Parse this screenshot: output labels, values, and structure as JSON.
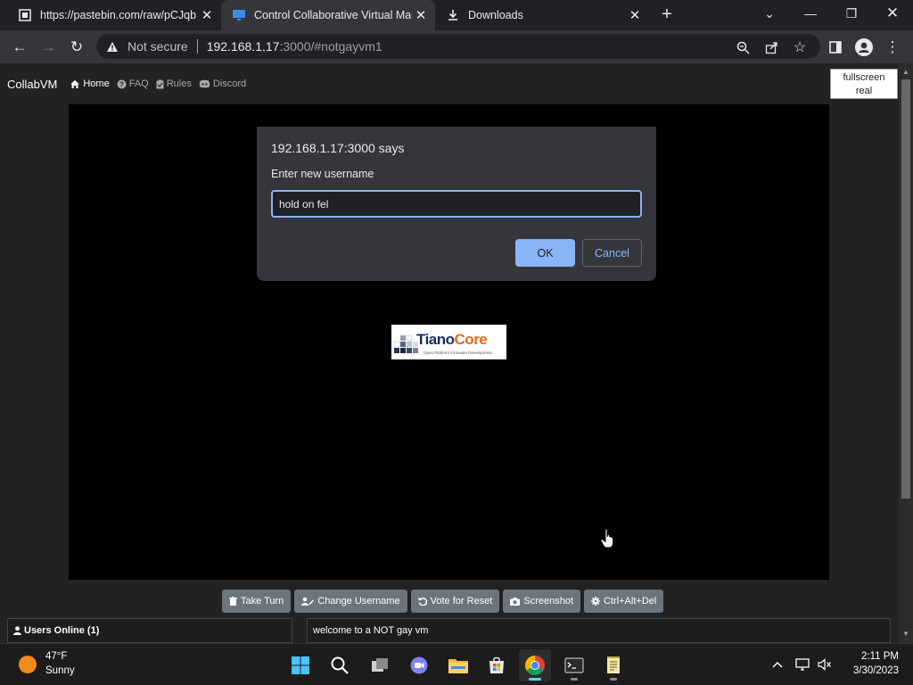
{
  "browser": {
    "tabs": [
      {
        "title": "https://pastebin.com/raw/pCJqb",
        "icon": "pastebin-icon",
        "active": false
      },
      {
        "title": "Control Collaborative Virtual Mac",
        "icon": "monitor-icon",
        "active": true
      },
      {
        "title": "Downloads",
        "icon": "download-icon",
        "active": false
      }
    ],
    "new_tab_label": "+",
    "omnibox": {
      "security_label": "Not secure",
      "url_host": "192.168.1.17",
      "url_rest": ":3000/#notgayvm1"
    }
  },
  "collabvm": {
    "brand": "CollabVM",
    "nav": [
      {
        "label": "Home",
        "icon": "home-icon"
      },
      {
        "label": "FAQ",
        "icon": "question-circle-icon"
      },
      {
        "label": "Rules",
        "icon": "clipboard-icon"
      },
      {
        "label": "Discord",
        "icon": "discord-icon"
      }
    ],
    "fullscreen_label_1": "fullscreen",
    "fullscreen_label_2": "real",
    "vm_logo": {
      "word_a": "Tiano",
      "word_b": "Core",
      "subtitle": "Open Platform Firmware Development"
    },
    "buttons": [
      {
        "label": "Take Turn",
        "icon": "trash-icon"
      },
      {
        "label": "Change Username",
        "icon": "user-edit-icon"
      },
      {
        "label": "Vote for Reset",
        "icon": "undo-icon"
      },
      {
        "label": "Screenshot",
        "icon": "camera-icon"
      },
      {
        "label": "Ctrl+Alt+Del",
        "icon": "cog-icon"
      }
    ],
    "users_online_label": "Users Online (1)",
    "chat_message": "welcome to a NOT gay vm"
  },
  "dialog": {
    "title": "192.168.1.17:3000 says",
    "message": "Enter new username",
    "input_value": "hold on fel",
    "ok_label": "OK",
    "cancel_label": "Cancel"
  },
  "taskbar": {
    "weather_temp": "47°F",
    "weather_condition": "Sunny",
    "time": "2:11 PM",
    "date": "3/30/2023"
  },
  "colors": {
    "accent": "#8ab4f8",
    "vm_button": "#6c757d",
    "tianocore_orange": "#e36b1a",
    "tianocore_navy": "#1a2a5a"
  }
}
